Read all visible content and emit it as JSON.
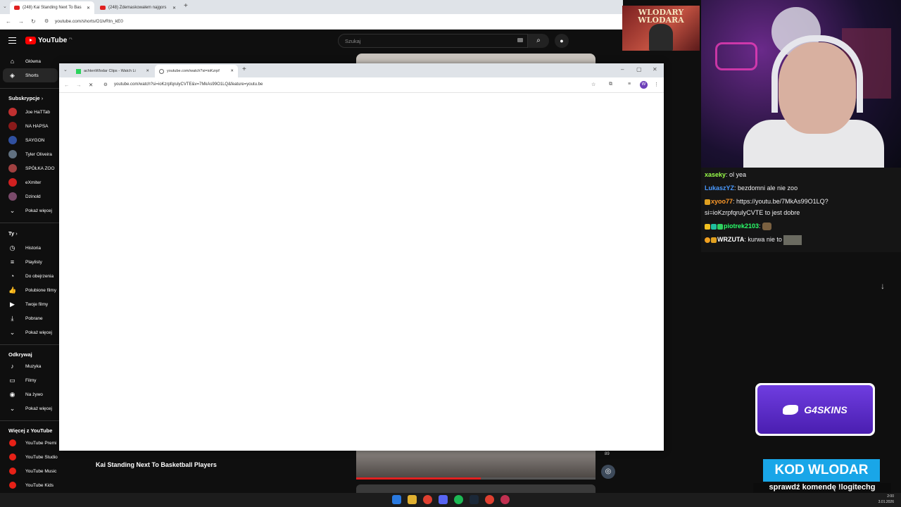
{
  "outer_browser": {
    "tabs": [
      {
        "label": "(248) Kai Standing Next To Bas"
      },
      {
        "label": "(248) Zdemaskowałem najgors"
      }
    ],
    "new_tab": "+",
    "url": "youtube.com/shorts/O1lvRtn_kE0"
  },
  "youtube": {
    "logo": "YouTube",
    "region": "PL",
    "search_placeholder": "Szukaj",
    "nav": [
      {
        "label": "Główna",
        "icon": "home-icon"
      },
      {
        "label": "Shorts",
        "icon": "shorts-icon"
      }
    ],
    "subscriptions_header": "Subskrypcje",
    "subscriptions": [
      {
        "label": "Joe HaTTab",
        "color": "#c03030"
      },
      {
        "label": "NA HAPSA",
        "color": "#8a1a1a"
      },
      {
        "label": "SAYGON",
        "color": "#3050a0"
      },
      {
        "label": "Tyler Oliveira",
        "color": "#607080"
      },
      {
        "label": "SPÓŁKA ZOO",
        "color": "#a04040"
      },
      {
        "label": "eXmiter",
        "color": "#d02020"
      },
      {
        "label": "Dzinold",
        "color": "#7a4a6a"
      }
    ],
    "show_more": "Pokaż więcej",
    "you_header": "Ty",
    "you_items": [
      {
        "label": "Historia",
        "icon": "history-icon"
      },
      {
        "label": "Playlisty",
        "icon": "playlist-icon"
      },
      {
        "label": "Do obejrzenia",
        "icon": "watch-later-icon"
      },
      {
        "label": "Polubione filmy",
        "icon": "like-icon"
      },
      {
        "label": "Twoje filmy",
        "icon": "your-videos-icon"
      },
      {
        "label": "Pobrane",
        "icon": "download-icon"
      }
    ],
    "you_more": "Pokaż więcej",
    "explore_header": "Odkrywaj",
    "explore_items": [
      {
        "label": "Muzyka",
        "icon": "music-icon"
      },
      {
        "label": "Filmy",
        "icon": "movies-icon"
      },
      {
        "label": "Na żywo",
        "icon": "live-icon"
      }
    ],
    "explore_more": "Pokaż więcej",
    "more_header": "Więcej z YouTube",
    "more_items": [
      {
        "label": "YouTube Premi"
      },
      {
        "label": "YouTube Studio"
      },
      {
        "label": "YouTube Music"
      },
      {
        "label": "YouTube Kids"
      }
    ],
    "short_title": "Kai Standing Next To Basketball Players",
    "short_count": "89",
    "short_progress": 0.52
  },
  "popup": {
    "tabs": [
      {
        "label": "achtenWlodar Clips - Watch Li"
      },
      {
        "label": "youtube.com/watch?si=ioKzrpf"
      }
    ],
    "new_tab": "+",
    "url": "youtube.com/watch?si=ioKzrpfqrulyCVTE&v=7MkAs99O1LQ&feature=youtu.be",
    "profile_initial": "W"
  },
  "stream": {
    "banner": "WLODARY WLODARA",
    "chat": [
      {
        "user": "xaseky",
        "color": "#9aff4a",
        "text": ": ol yea"
      },
      {
        "user": "LukaszYZ",
        "color": "#4a9aff",
        "text": ": bezdomni ale nie zoo"
      },
      {
        "user": "xyoo77",
        "color": "#ff9a2a",
        "text": ": https://youtu.be/7MkAs99O1LQ?"
      },
      {
        "user": "",
        "color": "#efeff1",
        "text": "si=ioKzrpfqrulyCVTE to jest dobre"
      },
      {
        "user": "piotrek2103",
        "color": "#2aff6a",
        "text": ":"
      },
      {
        "user": "WRZUTA",
        "color": "#ffffff",
        "text": ": kurwa nie to"
      }
    ],
    "sponsor": "G4SKINS",
    "code": "KOD WLODAR",
    "code_sub": "sprawdź komendę !logitechg"
  },
  "taskbar": {
    "time": "2:00",
    "date": "3.01.2026"
  }
}
